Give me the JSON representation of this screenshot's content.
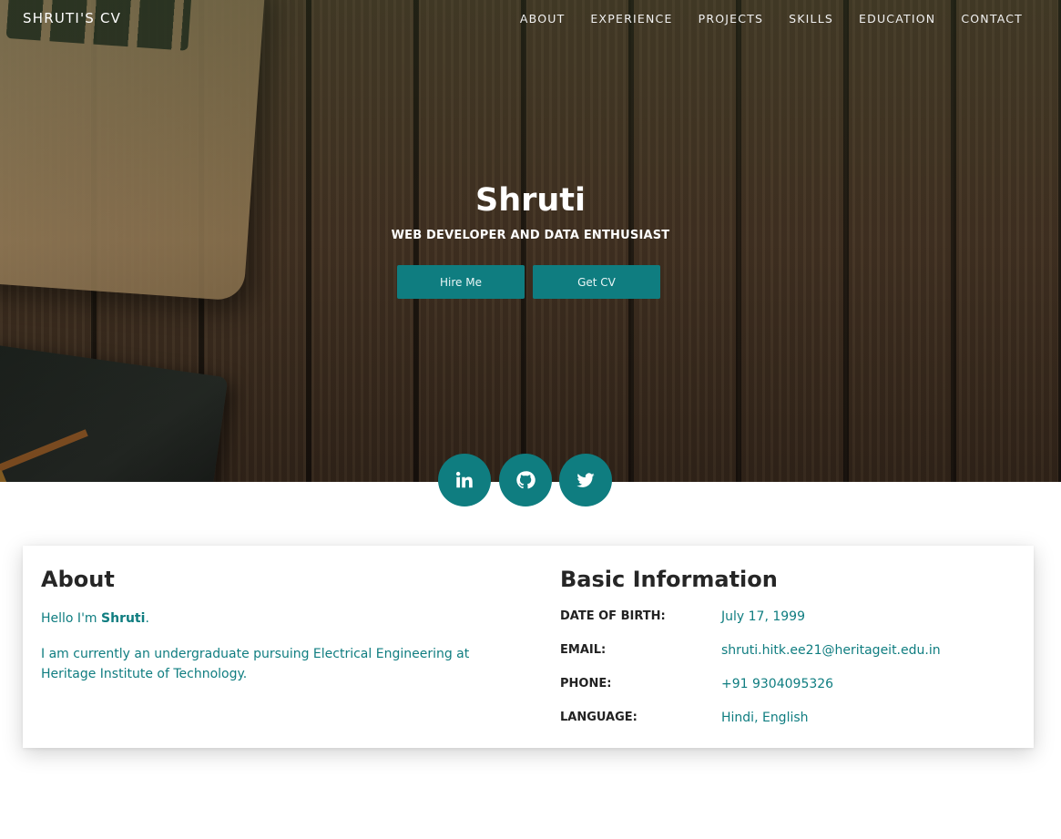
{
  "nav": {
    "brand": "SHRUTI'S CV",
    "links": [
      "ABOUT",
      "EXPERIENCE",
      "PROJECTS",
      "SKILLS",
      "EDUCATION",
      "CONTACT"
    ]
  },
  "hero": {
    "name": "Shruti",
    "subtitle": "WEB DEVELOPER AND DATA ENTHUSIAST",
    "hire_label": "Hire Me",
    "cv_label": "Get CV"
  },
  "social": {
    "icons": [
      "linkedin-icon",
      "github-icon",
      "twitter-icon"
    ]
  },
  "about": {
    "title": "About",
    "greeting_prefix": "Hello I'm ",
    "greeting_name": "Shruti",
    "greeting_suffix": ".",
    "description": "I am currently an undergraduate pursuing Electrical Engineering at Heritage Institute of Technology."
  },
  "basic_info": {
    "title": "Basic Information",
    "rows": [
      {
        "label": "DATE OF BIRTH:",
        "value": "July 17, 1999"
      },
      {
        "label": "EMAIL:",
        "value": "shruti.hitk.ee21@heritageit.edu.in"
      },
      {
        "label": "PHONE:",
        "value": "+91 9304095326"
      },
      {
        "label": "LANGUAGE:",
        "value": "Hindi, English"
      }
    ]
  },
  "colors": {
    "accent": "#0f7d80",
    "heading": "#262626"
  }
}
